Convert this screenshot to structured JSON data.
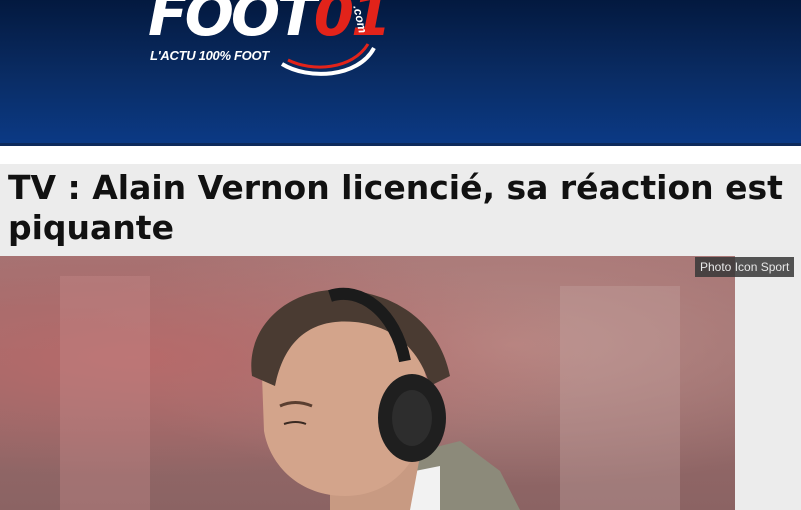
{
  "site": {
    "logo_main": "FOOT",
    "logo_number": "01",
    "logo_domain": ".com",
    "tagline": "L'ACTU 100% FOOT"
  },
  "article": {
    "title": "TV : Alain Vernon licencié, sa réaction est piquante",
    "photo_credit": "Photo Icon Sport"
  },
  "colors": {
    "header_top": "#03193f",
    "header_bottom": "#0b3a86",
    "logo_accent": "#e2231a"
  }
}
